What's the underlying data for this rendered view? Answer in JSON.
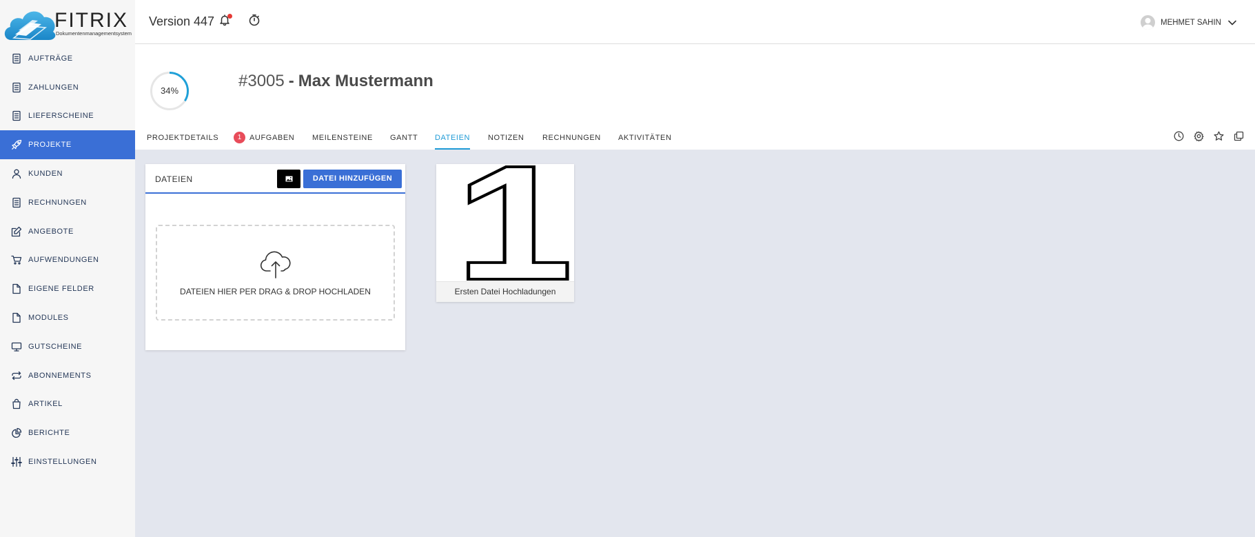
{
  "logo": {
    "name": "FITRIX",
    "tagline": "Dokumentenmanagementsystem"
  },
  "header": {
    "version": "Version 447",
    "notifications_icon": "bell-icon",
    "timer_icon": "stopwatch-icon",
    "user_name": "MEHMET SAHIN"
  },
  "sidebar": {
    "items": [
      {
        "label": "AUFTRÄGE",
        "icon": "document-icon"
      },
      {
        "label": "ZAHLUNGEN",
        "icon": "document-icon"
      },
      {
        "label": "LIEFERSCHEINE",
        "icon": "document-icon"
      },
      {
        "label": "PROJEKTE",
        "icon": "rocket-icon",
        "active": true
      },
      {
        "label": "KUNDEN",
        "icon": "user-icon"
      },
      {
        "label": "RECHNUNGEN",
        "icon": "document-icon"
      },
      {
        "label": "ANGEBOTE",
        "icon": "edit-icon"
      },
      {
        "label": "AUFWENDUNGEN",
        "icon": "cart-icon"
      },
      {
        "label": "EIGENE FELDER",
        "icon": "file-icon"
      },
      {
        "label": "MODULES",
        "icon": "file-icon"
      },
      {
        "label": "GUTSCHEINE",
        "icon": "monitor-icon"
      },
      {
        "label": "ABONNEMENTS",
        "icon": "repeat-icon"
      },
      {
        "label": "ARTIKEL",
        "icon": "shopping-bag-icon"
      },
      {
        "label": "BERICHTE",
        "icon": "pie-chart-icon"
      },
      {
        "label": "EINSTELLUNGEN",
        "icon": "sliders-icon"
      }
    ]
  },
  "project": {
    "progress_label": "34%",
    "progress_percent": 34,
    "number": "#3005",
    "separator": "-",
    "name": "Max Mustermann"
  },
  "tabs": {
    "items": [
      {
        "label": "PROJEKTDETAILS"
      },
      {
        "label": "AUFGABEN",
        "badge": "1"
      },
      {
        "label": "MEILENSTEINE"
      },
      {
        "label": "GANTT"
      },
      {
        "label": "DATEIEN",
        "active": true
      },
      {
        "label": "NOTIZEN"
      },
      {
        "label": "RECHNUNGEN"
      },
      {
        "label": "AKTIVITÄTEN"
      }
    ],
    "actions": [
      "clock-icon",
      "gear-icon",
      "star-icon",
      "copy-icon"
    ]
  },
  "files_card": {
    "title": "DATEIEN",
    "image_button_icon": "image-icon",
    "add_button": "DATEI HINZUFÜGEN",
    "dropzone_icon": "cloud-upload-icon",
    "dropzone_text": "DATEIEN HIER PER DRAG & DROP HOCHLADEN"
  },
  "file_tile": {
    "preview_text": "1",
    "caption": "Ersten Datei Hochladungen"
  },
  "colors": {
    "sidebar_active": "#3a6fd6",
    "primary_button": "#3a6fd6",
    "active_tab": "#1e9ad6",
    "progress": "#1fa0d8",
    "badge": "#e84c5a",
    "notification_dot": "#e53935",
    "content_background": "#e3e6ee"
  }
}
